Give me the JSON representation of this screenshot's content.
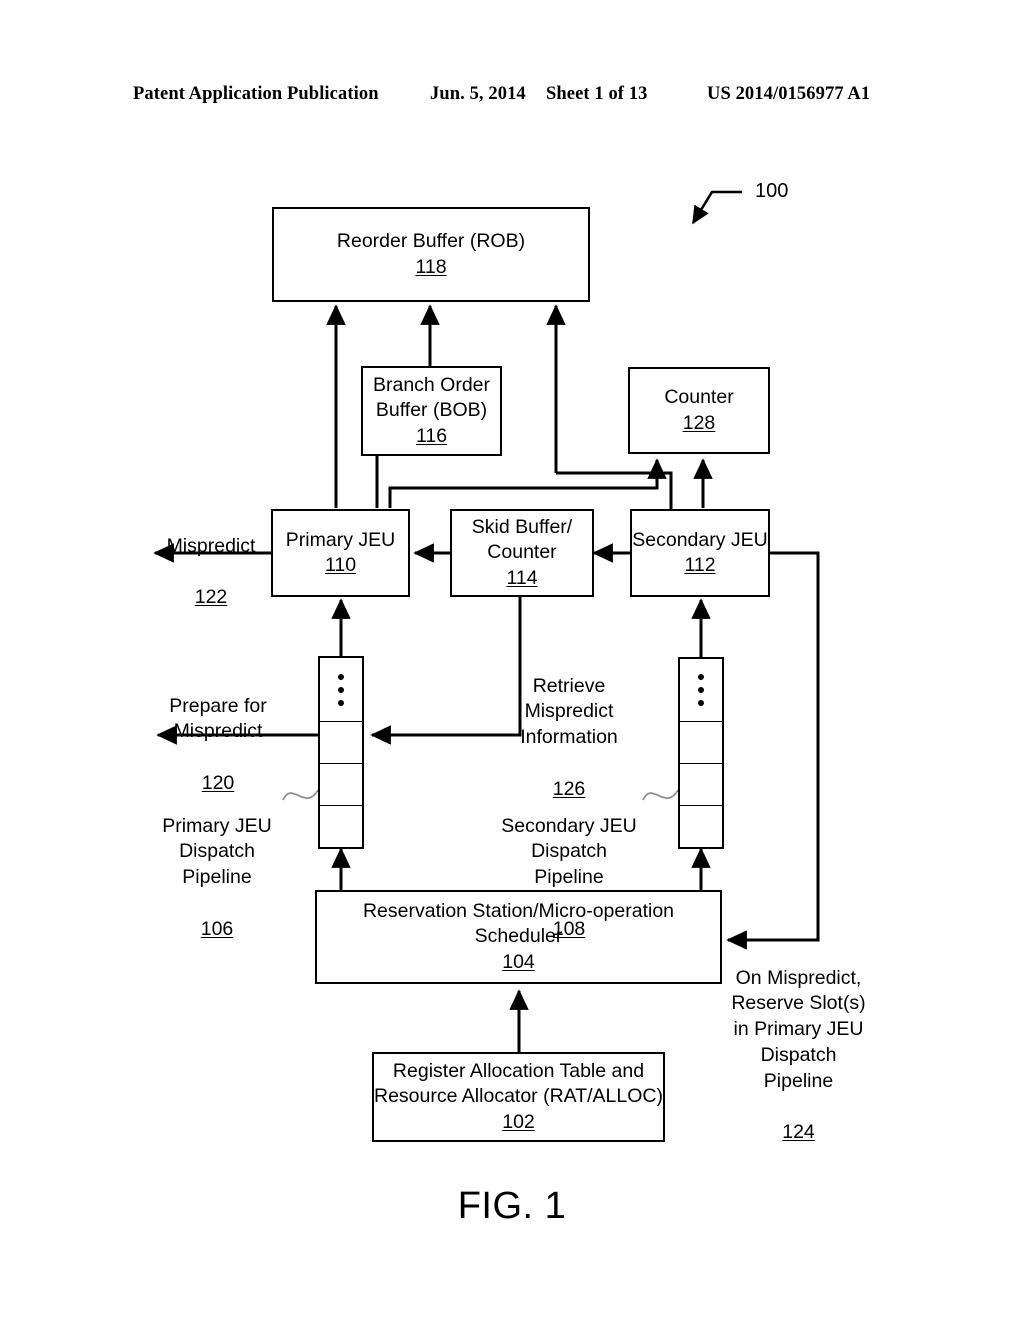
{
  "header": {
    "publication": "Patent Application Publication",
    "date": "Jun. 5, 2014",
    "sheet": "Sheet 1 of 13",
    "patent_number": "US 2014/0156977 A1"
  },
  "figure": {
    "caption": "FIG. 1",
    "system_ref": "100",
    "boxes": {
      "rob": {
        "title": "Reorder Buffer (ROB)",
        "ref": "118"
      },
      "bob": {
        "title": "Branch Order\nBuffer (BOB)",
        "ref": "116"
      },
      "counter": {
        "title": "Counter",
        "ref": "128"
      },
      "primary_jeu": {
        "title": "Primary JEU",
        "ref": "110"
      },
      "skid_buffer": {
        "title": "Skid Buffer/\nCounter",
        "ref": "114"
      },
      "secondary_jeu": {
        "title": "Secondary JEU",
        "ref": "112"
      },
      "reservation_station": {
        "title": "Reservation Station/Micro-operation Scheduler",
        "ref": "104"
      },
      "rat_alloc": {
        "title": "Register Allocation Table and\nResource Allocator (RAT/ALLOC)",
        "ref": "102"
      }
    },
    "labels": {
      "mispredict": {
        "title": "Mispredict",
        "ref": "122"
      },
      "prepare_for_mispredict": {
        "title": "Prepare for\nMispredict",
        "ref": "120"
      },
      "retrieve_mispredict_information": {
        "title": "Retrieve\nMispredict\nInformation",
        "ref": "126"
      },
      "primary_dispatch_pipeline": {
        "title": "Primary JEU\nDispatch\nPipeline",
        "ref": "106"
      },
      "secondary_dispatch_pipeline": {
        "title": "Secondary JEU\nDispatch\nPipeline",
        "ref": "108"
      },
      "on_mispredict_reserve": {
        "title": "On Mispredict,\nReserve Slot(s)\nin Primary JEU\nDispatch\nPipeline",
        "ref": "124"
      }
    }
  },
  "colors": {
    "ink": "#000000",
    "paper": "#ffffff"
  }
}
